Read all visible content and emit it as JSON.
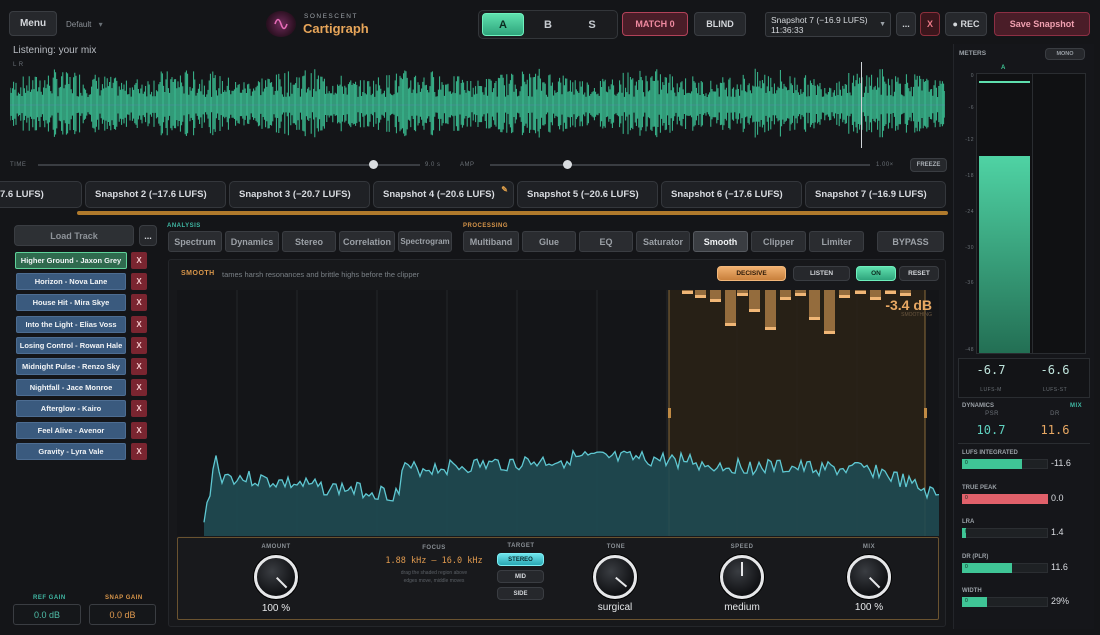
{
  "header": {
    "menu_label": "Menu",
    "preset_label": "Default",
    "preset_caret": "▾",
    "brand_small": "SONESCENT",
    "brand_name": "Cartigraph",
    "ab": [
      "A",
      "B",
      "S"
    ],
    "match_label": "MATCH 0",
    "blind_label": "BLIND",
    "snapshot_select": "Snapshot 7 (−16.9 LUFS)  11:36:33",
    "more_label": "...",
    "close_label": "X",
    "rec_label": "● REC",
    "save_snapshot_label": "Save Snapshot"
  },
  "waveform": {
    "listening": "Listening: your mix",
    "channels": "L R",
    "time_label": "TIME",
    "time_value": "9.0 s",
    "amp_label": "AMP",
    "amp_value": "1.00×",
    "freeze_label": "FREEZE"
  },
  "snapshots": [
    "7.6 LUFS)",
    "Snapshot 2 (−17.6 LUFS)",
    "Snapshot 3 (−20.7 LUFS)",
    "Snapshot 4 (−20.6 LUFS)",
    "Snapshot 5 (−20.6 LUFS)",
    "Snapshot 6 (−17.6 LUFS)",
    "Snapshot 7 (−16.9 LUFS)"
  ],
  "library": {
    "load_track_label": "Load Track",
    "more_label": "...",
    "tracks": [
      "Higher Ground - Jaxon Grey",
      "Horizon - Nova Lane",
      "House Hit - Mira Skye",
      "Into the Light - Elias Voss",
      "Losing Control - Rowan Hale",
      "Midnight Pulse - Renzo Sky",
      "Nightfall - Jace Monroe",
      "Afterglow - Kairo",
      "Feel Alive - Avenor",
      "Gravity - Lyra Vale"
    ],
    "remove_label": "X",
    "ref_gain_label": "REF GAIN",
    "ref_gain_value": "0.0 dB",
    "snap_gain_label": "SNAP GAIN",
    "snap_gain_value": "0.0 dB"
  },
  "analysis": {
    "label": "ANALYSIS",
    "tabs": [
      "Spectrum",
      "Dynamics",
      "Stereo",
      "Correlation",
      "Spectrogram"
    ]
  },
  "processing": {
    "label": "PROCESSING",
    "tabs": [
      "Multiband",
      "Glue",
      "EQ",
      "Saturator",
      "Smooth",
      "Clipper",
      "Limiter"
    ],
    "bypass_label": "BYPASS",
    "active_tab": "Smooth"
  },
  "smooth": {
    "title": "SMOOTH",
    "description": "tames harsh resonances and brittle highs before the clipper",
    "decisive_label": "DECISIVE",
    "listen_label": "LISTEN",
    "on_label": "ON",
    "reset_label": "RESET",
    "reduction_value": "-3.4 dB",
    "reduction_label": "SMOOTHING",
    "amount_label": "AMOUNT",
    "amount_value": "100 %",
    "amount_level": 1.0,
    "focus_label": "FOCUS",
    "focus_value": "1.88 kHz – 16.0 kHz",
    "focus_hint1": "drag the shaded region above",
    "focus_hint2": "edges move, middle moves",
    "target_label": "TARGET",
    "target_options": [
      "STEREO",
      "MID",
      "SIDE"
    ],
    "target_selected": "STEREO",
    "tone_label": "TONE",
    "tone_value": "surgical",
    "speed_label": "SPEED",
    "speed_value": "medium",
    "mix_label": "MIX",
    "mix_value": "100 %"
  },
  "meters": {
    "title": "METERS",
    "mono_label": "MONO",
    "channel_a": "A",
    "scale": [
      "0",
      "-6",
      "-12",
      "-18",
      "-24",
      "-30",
      "-36",
      "-48"
    ],
    "lufs_m_value": "-6.7",
    "lufs_m_label": "LUFS-M",
    "lufs_st_value": "-6.6",
    "lufs_st_label": "LUFS-ST",
    "dynamics_label": "DYNAMICS",
    "mix_label": "MIX",
    "psr_label": "PSR",
    "psr_value": "10.7",
    "dr_label": "DR",
    "dr_value": "11.6",
    "rows": [
      {
        "label": "LUFS INTEGRATED",
        "value": "-11.6",
        "level": 0.7,
        "color": "#3fc596"
      },
      {
        "label": "TRUE PEAK",
        "value": "0.0",
        "level": 1.0,
        "color": "#e0606a"
      },
      {
        "label": "LRA",
        "value": "1.4",
        "level": 0.05,
        "color": "#3fc596"
      },
      {
        "label": "DR (PLR)",
        "value": "11.6",
        "level": 0.58,
        "color": "#3fc596"
      },
      {
        "label": "WIDTH",
        "value": "29%",
        "level": 0.29,
        "color": "#3fc596"
      }
    ],
    "row_min": "0"
  }
}
